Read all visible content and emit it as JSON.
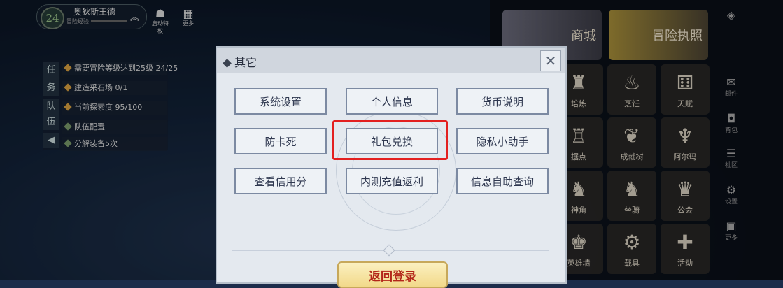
{
  "player": {
    "level": "24",
    "name": "奥狄斯王德",
    "title": "冒险经验"
  },
  "top_icons": [
    {
      "label": "启动特权",
      "icon": "ghost-icon"
    },
    {
      "label": "更多",
      "icon": "grid-icon"
    }
  ],
  "quest": {
    "tabs": [
      "任务",
      "队伍"
    ],
    "items": [
      "需要冒险等级达到25级 24/25",
      "建造采石场 0/1",
      "当前探索度 95/100",
      "队伍配置",
      "分解装备5次"
    ]
  },
  "right_menu": {
    "big_tiles": [
      "商城",
      "冒险执照"
    ],
    "tiles": [
      "培炼",
      "烹饪",
      "天赋",
      "据点",
      "成就树",
      "阿尔玛",
      "神角",
      "坐骑",
      "公会",
      "英雄墙",
      "载具",
      "活动"
    ],
    "side": [
      "邮件",
      "背包",
      "社区",
      "设置",
      "更多"
    ]
  },
  "dialog": {
    "title": "其它",
    "options": [
      [
        "系统设置",
        "个人信息",
        "货币说明"
      ],
      [
        "防卡死",
        "礼包兑换",
        "隐私小助手"
      ],
      [
        "查看信用分",
        "内测充值返利",
        "信息自助查询"
      ]
    ],
    "back_button": "返回登录"
  },
  "colors": {
    "highlight": "#e32020",
    "dialog_bg": "#e4e9ef",
    "button_text": "#b3261a"
  }
}
